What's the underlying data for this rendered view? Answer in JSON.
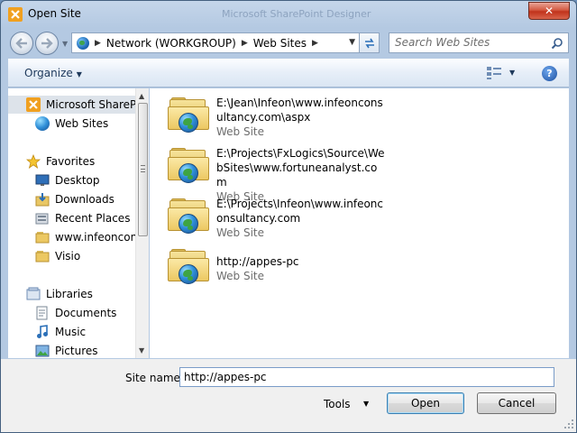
{
  "window": {
    "title": "Open Site",
    "background_title": "Microsoft SharePoint Designer",
    "close_glyph": "✕"
  },
  "nav": {
    "back_icon": "back-arrow-icon",
    "forward_icon": "forward-arrow-icon",
    "breadcrumbs": [
      "Network (WORKGROUP)",
      "Web Sites"
    ],
    "search_placeholder": "Search Web Sites"
  },
  "toolbar": {
    "organize_label": "Organize",
    "help_glyph": "?"
  },
  "sidebar": {
    "items": [
      {
        "label": "Microsoft SharePoint",
        "icon": "sharepoint-icon",
        "selected": true
      },
      {
        "label": "Web Sites",
        "icon": "globe-icon"
      },
      {
        "label": "Favorites",
        "icon": "star-icon"
      },
      {
        "label": "Desktop",
        "icon": "desktop-icon"
      },
      {
        "label": "Downloads",
        "icon": "downloads-icon"
      },
      {
        "label": "Recent Places",
        "icon": "recent-places-icon"
      },
      {
        "label": "www.infeonconsultancy",
        "icon": "folder-icon"
      },
      {
        "label": "Visio",
        "icon": "folder-icon"
      },
      {
        "label": "Libraries",
        "icon": "libraries-icon"
      },
      {
        "label": "Documents",
        "icon": "documents-icon"
      },
      {
        "label": "Music",
        "icon": "music-icon"
      },
      {
        "label": "Pictures",
        "icon": "pictures-icon"
      }
    ]
  },
  "files": [
    {
      "name": "E:\\Jean\\Infeon\\www.infeonconsultancy.com\\aspx",
      "type": "Web Site"
    },
    {
      "name": "E:\\Projects\\FxLogics\\Source\\WebSites\\www.fortuneanalyst.com",
      "type": "Web Site"
    },
    {
      "name": "E:\\Projects\\Infeon\\www.infeonconsultancy.com",
      "type": "Web Site"
    },
    {
      "name": "http://appes-pc",
      "type": "Web Site"
    }
  ],
  "bottom": {
    "site_name_label": "Site name:",
    "site_name_value": "http://appes-pc",
    "tools_label": "Tools",
    "open_label": "Open",
    "cancel_label": "Cancel"
  },
  "colors": {
    "accent": "#1e395b",
    "folder": "#ecc862",
    "secondary_text": "#6d6d6d",
    "close_button": "#c0321b"
  }
}
